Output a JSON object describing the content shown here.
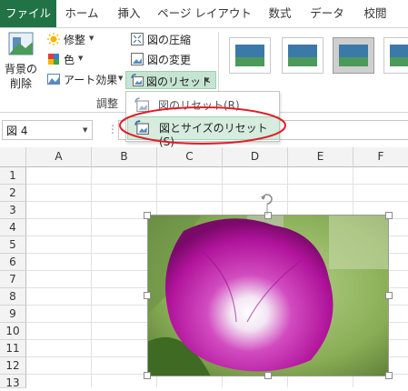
{
  "tabs": [
    "ファイル",
    "ホーム",
    "挿入",
    "ページ レイアウト",
    "数式",
    "データ",
    "校閲"
  ],
  "ribbon": {
    "background_remove": [
      "背景の",
      "削除"
    ],
    "corrections": "修整",
    "color": "色",
    "artistic_effects": "アート効果",
    "compress": "図の圧縮",
    "change_picture": "図の変更",
    "reset_picture": "図のリセット",
    "group_label": "調整"
  },
  "menu": {
    "items": [
      "図のリセット(R)",
      "図とサイズのリセット(S)"
    ]
  },
  "formula_bar": {
    "name_box": "図 4"
  },
  "sheet": {
    "columns": [
      "A",
      "B",
      "C",
      "D",
      "E",
      "F"
    ],
    "rows": [
      "1",
      "2",
      "3",
      "4",
      "5",
      "6",
      "7",
      "8",
      "9",
      "10",
      "11",
      "12",
      "13"
    ]
  },
  "colors": {
    "file_tab": "#217346",
    "highlight": "#d5ecdf",
    "annotation": "#e0202a",
    "flower": "#b0139a"
  },
  "icons": [
    "remove-background-icon",
    "corrections-icon",
    "color-icon",
    "artistic-effects-icon",
    "compress-icon",
    "change-picture-icon",
    "reset-picture-icon",
    "rotate-handle-icon"
  ]
}
